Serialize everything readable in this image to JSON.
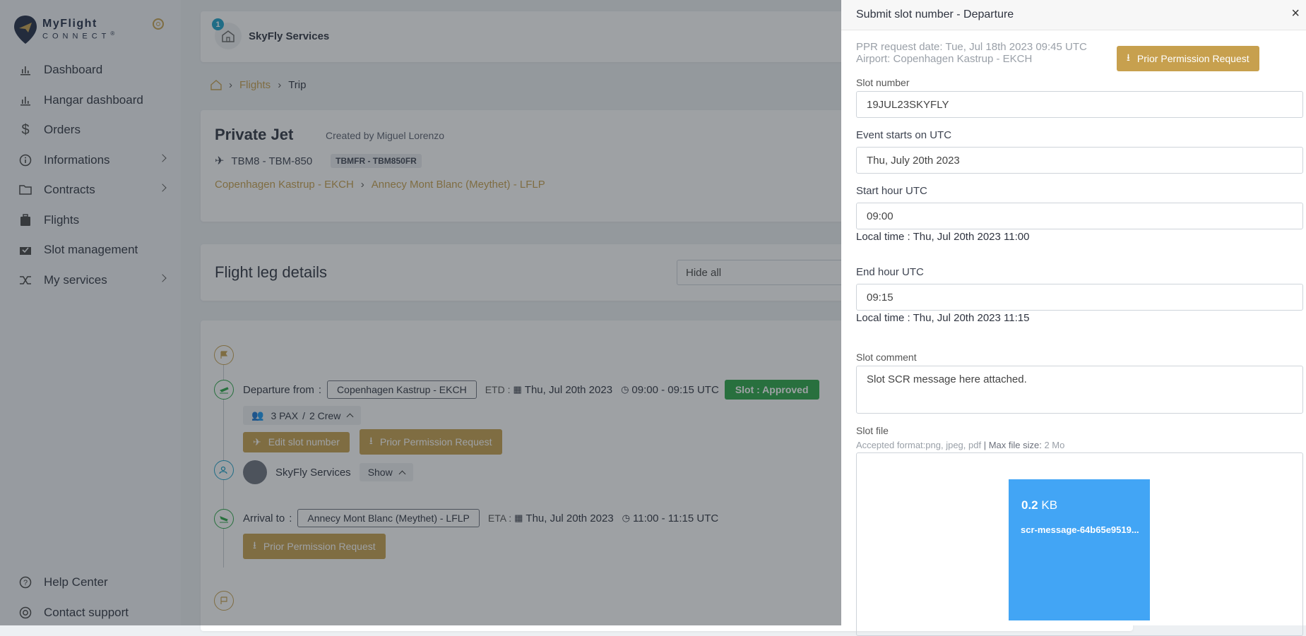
{
  "brand": {
    "line1": "MyFlight",
    "line2": "CONNECT",
    "reg": "®"
  },
  "sidebar": {
    "items": [
      {
        "label": "Dashboard",
        "icon": "bar-chart-icon"
      },
      {
        "label": "Hangar dashboard",
        "icon": "bar-chart-icon"
      },
      {
        "label": "Orders",
        "icon": "dollar-icon"
      },
      {
        "label": "Informations",
        "icon": "info-icon"
      },
      {
        "label": "Contracts",
        "icon": "folder-icon"
      },
      {
        "label": "Flights",
        "icon": "briefcase-icon"
      },
      {
        "label": "Slot management",
        "icon": "inbox-check-icon"
      },
      {
        "label": "My services",
        "icon": "shuffle-icon"
      }
    ],
    "bottom": [
      {
        "label": "Help Center",
        "icon": "help-icon"
      },
      {
        "label": "Contact support",
        "icon": "lifebuoy-icon"
      }
    ]
  },
  "org": {
    "name": "SkyFly Services",
    "badge": "1"
  },
  "breadcrumb": {
    "flights": "Flights",
    "trip": "Trip"
  },
  "trip": {
    "title": "Private Jet",
    "created": "Created by Miguel Lorenzo",
    "aircraft": "TBM8 - TBM-850",
    "tag": "TBMFR - TBM850FR",
    "from": "Copenhagen Kastrup - EKCH",
    "to": "Annecy Mont Blanc (Meythet) - LFLP"
  },
  "leg": {
    "title": "Flight leg details",
    "hide_select": "Hide all"
  },
  "timeline": {
    "departure_label": "Departure from",
    "departure_airport": "Copenhagen Kastrup - EKCH",
    "etd_label": "ETD :",
    "etd_date": "Thu, Jul 20th 2023",
    "etd_time": "09:00 - 09:15 UTC",
    "slot_status": "Slot : Approved",
    "pax": "3 PAX",
    "crew": "2 Crew",
    "edit_slot": "Edit slot number",
    "ppr": "Prior Permission Request",
    "service_name": "SkyFly Services",
    "show": "Show",
    "arrival_label": "Arrival to",
    "arrival_airport": "Annecy Mont Blanc (Meythet) - LFLP",
    "eta_label": "ETA :",
    "eta_date": "Thu, Jul 20th 2023",
    "eta_time": "11:00 - 11:15 UTC",
    "ppr2": "Prior Permission Request"
  },
  "drawer": {
    "title": "Submit slot number - Departure",
    "ppr_date": "PPR request date: Tue, Jul 18th 2023 09:45 UTC",
    "airport": "Airport: Copenhagen Kastrup - EKCH",
    "ppr_button": "Prior Permission Request",
    "slot_number_label": "Slot number",
    "slot_number_value": "19JUL23SKYFLY",
    "event_label": "Event starts on UTC",
    "event_value": "Thu, July 20th 2023",
    "start_label": "Start hour UTC",
    "start_value": "09:00",
    "start_local": "Local time : Thu, Jul 20th 2023 11:00",
    "end_label": "End hour UTC",
    "end_value": "09:15",
    "end_local": "Local time : Thu, Jul 20th 2023 11:15",
    "comment_label": "Slot comment",
    "comment_value": "Slot SCR message here attached.",
    "file_label": "Slot file",
    "accepted_prefix": "Accepted format:",
    "accepted_formats": "png, jpeg, pdf",
    "accepted_sep": " | ",
    "max_size_label": "Max file size:",
    "max_size_value": " 2 Mo",
    "file_size_num": "0.2",
    "file_size_unit": " KB",
    "file_name": "scr-message-64b65e9519..."
  },
  "colors": {
    "gold": "#c7a04e",
    "green": "#28a745",
    "teal": "#1aa1c9",
    "file_blue": "#42a5f5"
  }
}
